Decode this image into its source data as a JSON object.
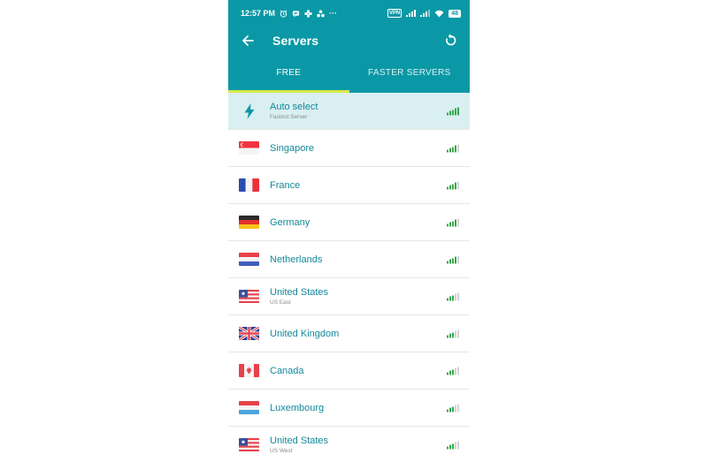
{
  "status_bar": {
    "time": "12:57 PM",
    "left_icons": [
      "alarm-icon",
      "message-icon",
      "app-icon",
      "share-icon",
      "more-icon"
    ],
    "more": "···",
    "vpn": "VPN",
    "battery": "48"
  },
  "app_bar": {
    "title": "Servers",
    "back_icon": "arrow-left-icon",
    "refresh_icon": "refresh-icon"
  },
  "tabs": [
    {
      "label": "FREE",
      "active": true
    },
    {
      "label": "FASTER SERVERS",
      "active": false
    }
  ],
  "colors": {
    "accent": "#0b98a6",
    "tab_indicator": "#d7e84a",
    "selected_row": "#d9eff1",
    "signal_on": "#35a84b",
    "signal_off": "#d4d4d4",
    "text": "#14889a"
  },
  "servers": [
    {
      "name": "Auto select",
      "sub": "Fastest Server",
      "icon": "bolt-icon",
      "signal": 5,
      "selected": true
    },
    {
      "name": "Singapore",
      "sub": "",
      "icon": "flag-singapore-icon",
      "signal": 4,
      "selected": false
    },
    {
      "name": "France",
      "sub": "",
      "icon": "flag-france-icon",
      "signal": 4,
      "selected": false
    },
    {
      "name": "Germany",
      "sub": "",
      "icon": "flag-germany-icon",
      "signal": 4,
      "selected": false
    },
    {
      "name": "Netherlands",
      "sub": "",
      "icon": "flag-netherlands-icon",
      "signal": 4,
      "selected": false
    },
    {
      "name": "United States",
      "sub": "US East",
      "icon": "flag-usa-icon",
      "signal": 3,
      "selected": false
    },
    {
      "name": "United Kingdom",
      "sub": "",
      "icon": "flag-uk-icon",
      "signal": 3,
      "selected": false
    },
    {
      "name": "Canada",
      "sub": "",
      "icon": "flag-canada-icon",
      "signal": 3,
      "selected": false
    },
    {
      "name": "Luxembourg",
      "sub": "",
      "icon": "flag-luxembourg-icon",
      "signal": 3,
      "selected": false
    },
    {
      "name": "United States",
      "sub": "US West",
      "icon": "flag-usa-icon",
      "signal": 3,
      "selected": false
    }
  ]
}
